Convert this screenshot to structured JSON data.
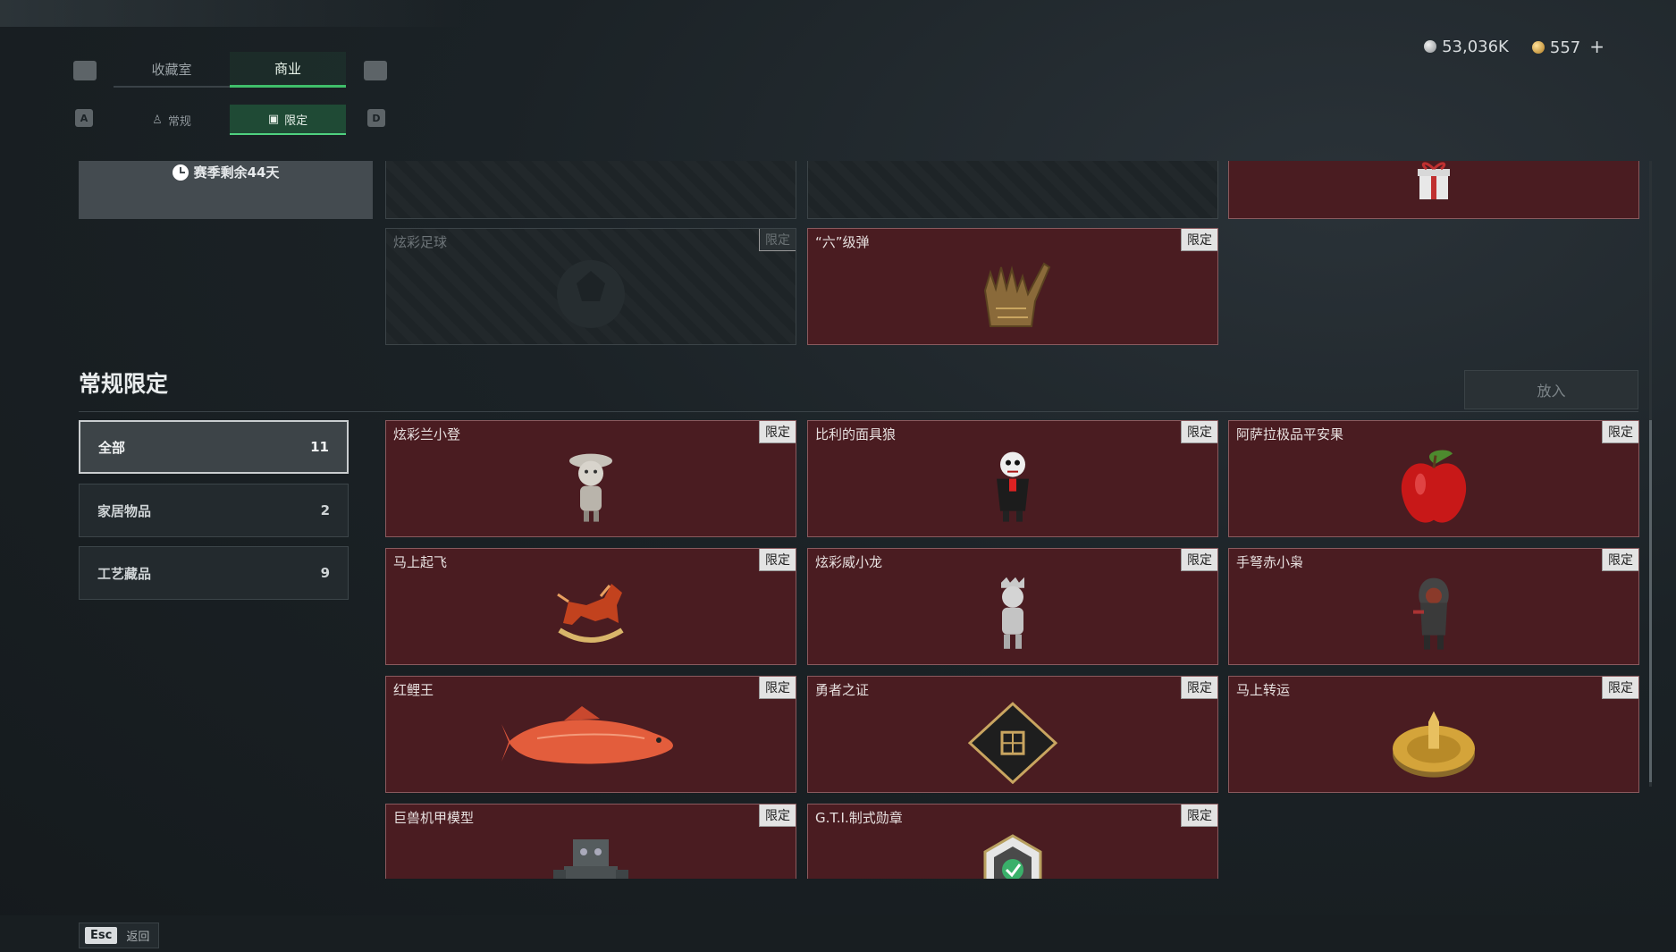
{
  "topbar": {
    "tabs": [
      "收藏室",
      "商业"
    ],
    "active_tab": 1,
    "subtabs": [
      "常规",
      "限定"
    ],
    "active_subtab": 1,
    "subtab_keys": [
      "A",
      "D"
    ]
  },
  "currency": {
    "silver": "53,036K",
    "gold": "557",
    "add": "+"
  },
  "season": {
    "text": "赛季剩余44天"
  },
  "top_cards": [
    {
      "name": "",
      "badge": "",
      "locked": true
    },
    {
      "name": "",
      "badge": "",
      "locked": true
    },
    {
      "name": "",
      "badge": "",
      "locked": false
    },
    {
      "name": "炫彩足球",
      "badge": "限定",
      "locked": true
    },
    {
      "name": "“六”级弹",
      "badge": "限定",
      "locked": false
    }
  ],
  "section": {
    "title": "常规限定",
    "put_button": "放入"
  },
  "categories": [
    {
      "label": "全部",
      "count": "11"
    },
    {
      "label": "家居物品",
      "count": "2"
    },
    {
      "label": "工艺藏品",
      "count": "9"
    }
  ],
  "items": [
    {
      "name": "炫彩兰小登",
      "badge": "限定",
      "icon": "figure-doll-icon"
    },
    {
      "name": "比利的面具狼",
      "badge": "限定",
      "icon": "masked-puppet-icon"
    },
    {
      "name": "阿萨拉极品平安果",
      "badge": "限定",
      "icon": "apple-icon"
    },
    {
      "name": "马上起飞",
      "badge": "限定",
      "icon": "rocking-horse-icon"
    },
    {
      "name": "炫彩威小龙",
      "badge": "限定",
      "icon": "dragon-figure-icon"
    },
    {
      "name": "手弩赤小枭",
      "badge": "限定",
      "icon": "hooded-figure-icon"
    },
    {
      "name": "红鲤王",
      "badge": "限定",
      "icon": "carp-fish-icon"
    },
    {
      "name": "勇者之证",
      "badge": "限定",
      "icon": "badge-card-icon"
    },
    {
      "name": "马上转运",
      "badge": "限定",
      "icon": "gold-wheel-icon"
    },
    {
      "name": "巨兽机甲模型",
      "badge": "限定",
      "icon": "mech-model-icon"
    },
    {
      "name": "G.T.I.制式勋章",
      "badge": "限定",
      "icon": "medal-icon"
    }
  ],
  "footer": {
    "key": "Esc",
    "label": "返回"
  },
  "colors": {
    "accent": "#3fbf6a",
    "card_bg": "#4a1c21",
    "badge_bg": "#e3e3e3"
  }
}
